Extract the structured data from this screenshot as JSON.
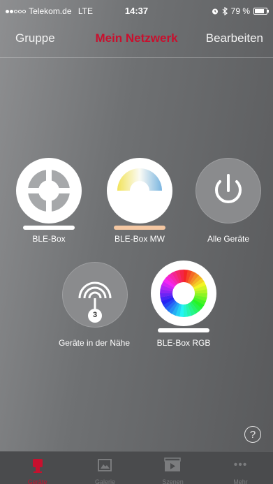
{
  "status_bar": {
    "carrier": "Telekom.de",
    "network": "LTE",
    "time": "14:37",
    "battery": "79 %",
    "battery_level": 0.79
  },
  "nav": {
    "left_label": "Gruppe",
    "title": "Mein Netzwerk",
    "right_label": "Bearbeiten"
  },
  "devices": [
    {
      "label": "BLE-Box",
      "icon": "crosshair-icon",
      "bar_color": "#ffffff"
    },
    {
      "label": "BLE-Box MW",
      "icon": "white-temperature-dial-icon",
      "bar_color": "#f4c7a2"
    },
    {
      "label": "Alle Geräte",
      "icon": "power-icon"
    },
    {
      "label": "Geräte in der Nähe",
      "icon": "nearby-signal-icon",
      "badge": "3"
    },
    {
      "label": "BLE-Box RGB",
      "icon": "color-wheel-icon",
      "bar_color": "#ffffff"
    }
  ],
  "help": {
    "label": "?"
  },
  "tabs": [
    {
      "label": "Geräte",
      "icon": "bulb-icon",
      "active": true
    },
    {
      "label": "Galerie",
      "icon": "gallery-icon",
      "active": false
    },
    {
      "label": "Szenen",
      "icon": "scene-play-icon",
      "active": false
    },
    {
      "label": "Mehr",
      "icon": "more-icon",
      "active": false
    }
  ],
  "colors": {
    "accent": "#c8102e"
  }
}
